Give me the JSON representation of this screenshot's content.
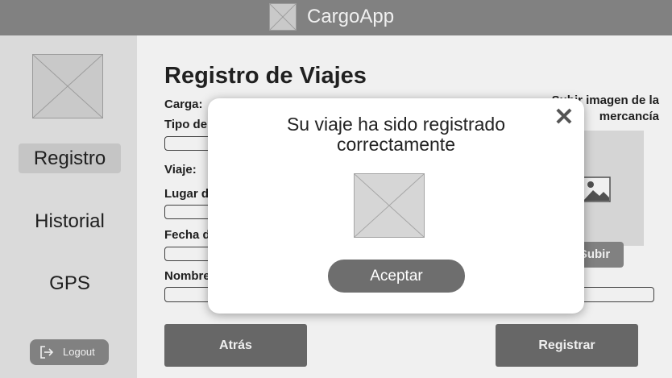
{
  "header": {
    "app_title": "CargoApp",
    "logo_icon": "image-placeholder-icon"
  },
  "sidebar": {
    "avatar_icon": "image-placeholder-icon",
    "items": [
      {
        "label": "Registro",
        "active": true
      },
      {
        "label": "Historial",
        "active": false
      },
      {
        "label": "GPS",
        "active": false
      }
    ],
    "logout_label": "Logout",
    "logout_icon": "logout-icon"
  },
  "main": {
    "title": "Registro de Viajes",
    "labels": {
      "carga": "Carga:",
      "tipo": "Tipo de",
      "viaje": "Viaje:",
      "lugar": "Lugar d",
      "fecha": "Fecha d",
      "nombre": "Nombre"
    },
    "upload": {
      "label": "Subir imagen de la mercancía",
      "button_label": "Subir",
      "preview_icon": "image-icon"
    },
    "back_label": "Atrás",
    "register_label": "Registrar"
  },
  "modal": {
    "message": "Su viaje ha sido registrado correctamente",
    "close_icon": "close-icon",
    "close_glyph": "✕",
    "image_icon": "image-placeholder-icon",
    "accept_label": "Aceptar"
  },
  "colors": {
    "header_bg": "#8a8a8a",
    "sidebar_bg": "#e8e8e8",
    "button_dark": "#6e6e6e",
    "active_nav": "#d2d2d2"
  }
}
